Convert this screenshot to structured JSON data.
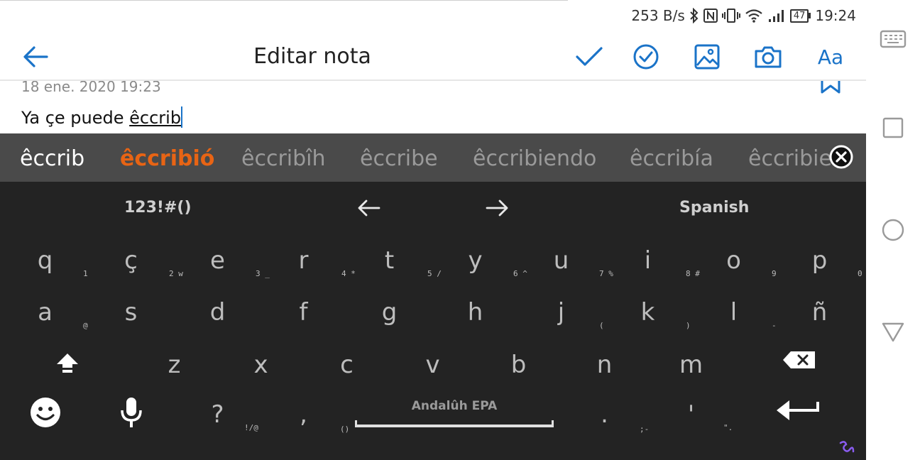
{
  "status_bar": {
    "network_speed": "253 B/s",
    "battery": "47",
    "time": "19:24",
    "icons": [
      "bluetooth-icon",
      "nfc-icon",
      "vibrate-icon",
      "wifi-icon",
      "signal-icon",
      "battery-icon"
    ]
  },
  "app_bar": {
    "title": "Editar nota",
    "back_icon": "arrow-left-icon",
    "actions": [
      "check-icon",
      "check-circle-icon",
      "image-icon",
      "camera-icon"
    ],
    "text_format_label": "Aa",
    "accent_color": "#1a73c8"
  },
  "note": {
    "date": "18 ene. 2020 19:23",
    "text_prefix": "Ya çe puede ",
    "text_composing": "êccrib"
  },
  "keyboard": {
    "colors": {
      "background": "#232323",
      "suggestion_bar": "#4a4a4a",
      "highlight": "#e86414"
    },
    "suggestions": [
      "êccrib",
      "êccribió",
      "êccribîh",
      "êccribe",
      "êccribiendo",
      "êccribía",
      "êccribien"
    ],
    "tool_row": {
      "numbers_label": "123!#()",
      "language_label": "Spanish"
    },
    "rows": [
      [
        {
          "key": "q",
          "sub": "1"
        },
        {
          "key": "ç",
          "sub": "2 w"
        },
        {
          "key": "e",
          "sub": "3 _"
        },
        {
          "key": "r",
          "sub": "4 *"
        },
        {
          "key": "t",
          "sub": "5 /"
        },
        {
          "key": "y",
          "sub": "6 ^"
        },
        {
          "key": "u",
          "sub": "7 %"
        },
        {
          "key": "i",
          "sub": "8 #"
        },
        {
          "key": "o",
          "sub": "9"
        },
        {
          "key": "p",
          "sub": "0"
        }
      ],
      [
        {
          "key": "a",
          "sub": "@"
        },
        {
          "key": "s",
          "sub": ""
        },
        {
          "key": "d",
          "sub": ""
        },
        {
          "key": "f",
          "sub": ""
        },
        {
          "key": "g",
          "sub": ""
        },
        {
          "key": "h",
          "sub": ""
        },
        {
          "key": "j",
          "sub": "("
        },
        {
          "key": "k",
          "sub": ")"
        },
        {
          "key": "l",
          "sub": "-"
        },
        {
          "key": "ñ",
          "sub": ""
        }
      ],
      [
        {
          "key": "z",
          "sub": ""
        },
        {
          "key": "x",
          "sub": ""
        },
        {
          "key": "c",
          "sub": ""
        },
        {
          "key": "v",
          "sub": ""
        },
        {
          "key": "b",
          "sub": ""
        },
        {
          "key": "n",
          "sub": ""
        },
        {
          "key": "m",
          "sub": ""
        }
      ]
    ],
    "bottom_row": {
      "question_key": "?",
      "question_sub": "!/@",
      "comma_key": ",",
      "comma_sub": "()",
      "space_label": "Andalûh EPA",
      "period_key": ".",
      "period_sub": ";-",
      "apostrophe_key": "'",
      "apostrophe_sub": "\"."
    }
  }
}
